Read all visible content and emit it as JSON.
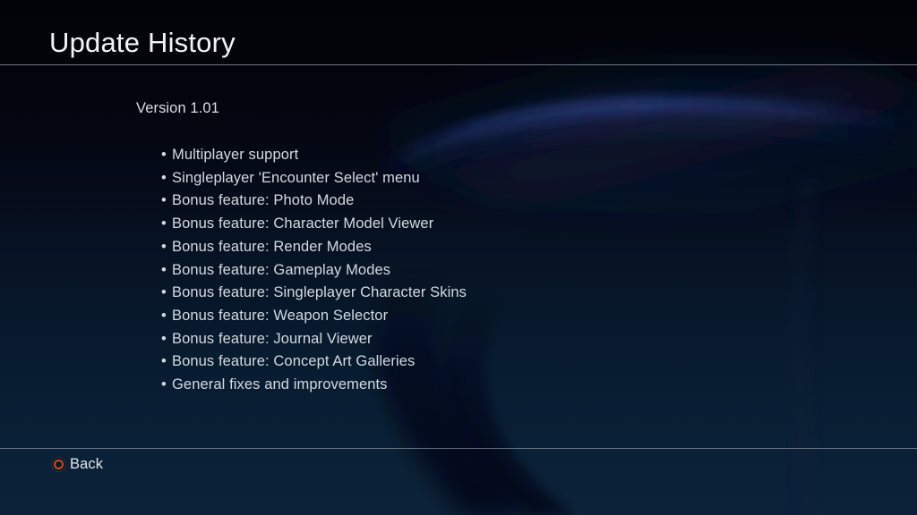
{
  "header": {
    "title": "Update History"
  },
  "content": {
    "version_label": "Version 1.01",
    "changes": [
      "Multiplayer support",
      "Singleplayer 'Encounter Select' menu",
      "Bonus feature: Photo Mode",
      "Bonus feature: Character Model Viewer",
      "Bonus feature: Render Modes",
      "Bonus feature: Gameplay Modes",
      "Bonus feature: Singleplayer Character Skins",
      "Bonus feature: Weapon Selector",
      "Bonus feature: Journal Viewer",
      "Bonus feature: Concept Art Galleries",
      "General fixes and improvements"
    ],
    "bullet_glyph": "•"
  },
  "footer": {
    "back_label": "Back",
    "back_icon": "circle-button-icon"
  },
  "colors": {
    "background_top": "#020308",
    "background_bottom": "#0b2239",
    "text": "#d4dae0",
    "title": "#f2f4f7",
    "divider": "#cdd4de",
    "circle_button_accent": "#c1502a"
  }
}
